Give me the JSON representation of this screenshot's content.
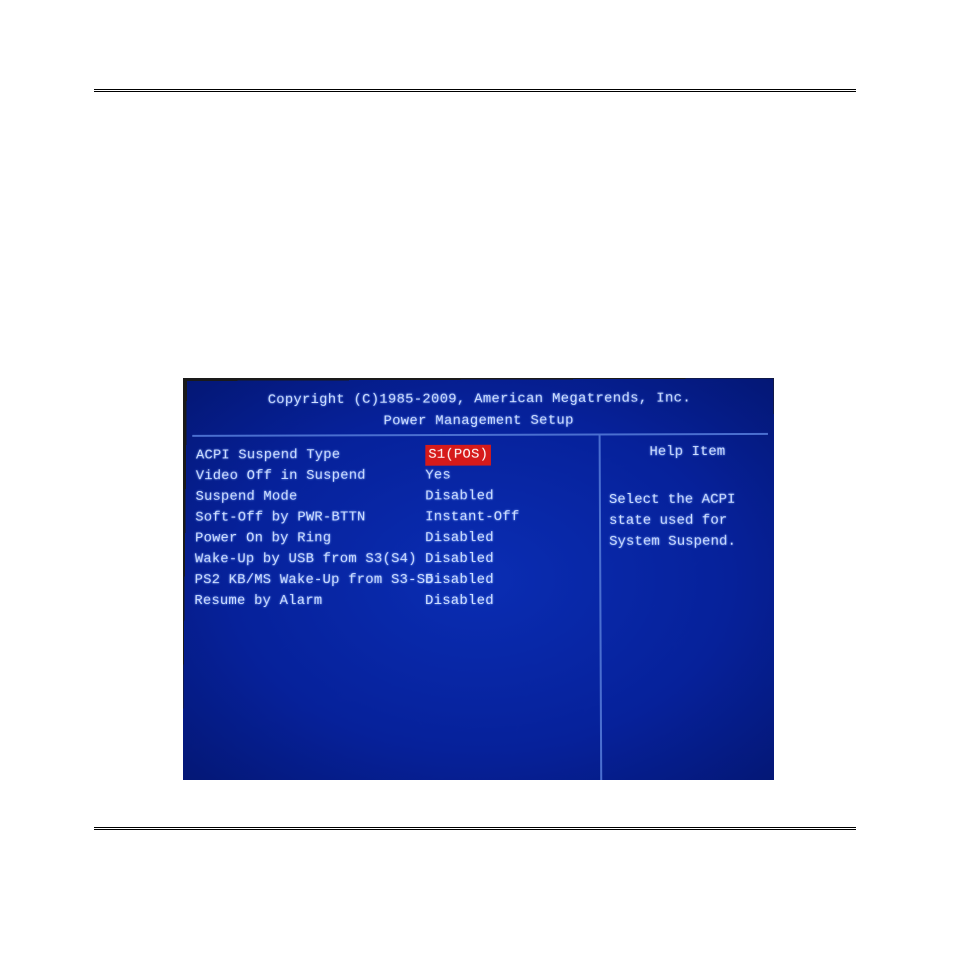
{
  "header": {
    "copyright": "Copyright (C)1985-2009, American Megatrends, Inc.",
    "title": "Power Management Setup"
  },
  "settings": [
    {
      "label": "ACPI Suspend Type",
      "value": "S1(POS)",
      "selected": true
    },
    {
      "label": "Video Off in Suspend",
      "value": "Yes",
      "selected": false
    },
    {
      "label": "Suspend Mode",
      "value": "Disabled",
      "selected": false
    },
    {
      "label": "Soft-Off by PWR-BTTN",
      "value": "Instant-Off",
      "selected": false
    },
    {
      "label": "Power On by Ring",
      "value": "Disabled",
      "selected": false
    },
    {
      "label": "Wake-Up by USB from S3(S4)",
      "value": "Disabled",
      "selected": false
    },
    {
      "label": "PS2 KB/MS Wake-Up from S3-S5",
      "value": "Disabled",
      "selected": false
    },
    {
      "label": "Resume by Alarm",
      "value": "Disabled",
      "selected": false
    }
  ],
  "help": {
    "heading": "Help Item",
    "text": "Select the ACPI state used for System Suspend."
  },
  "page_number": "—"
}
